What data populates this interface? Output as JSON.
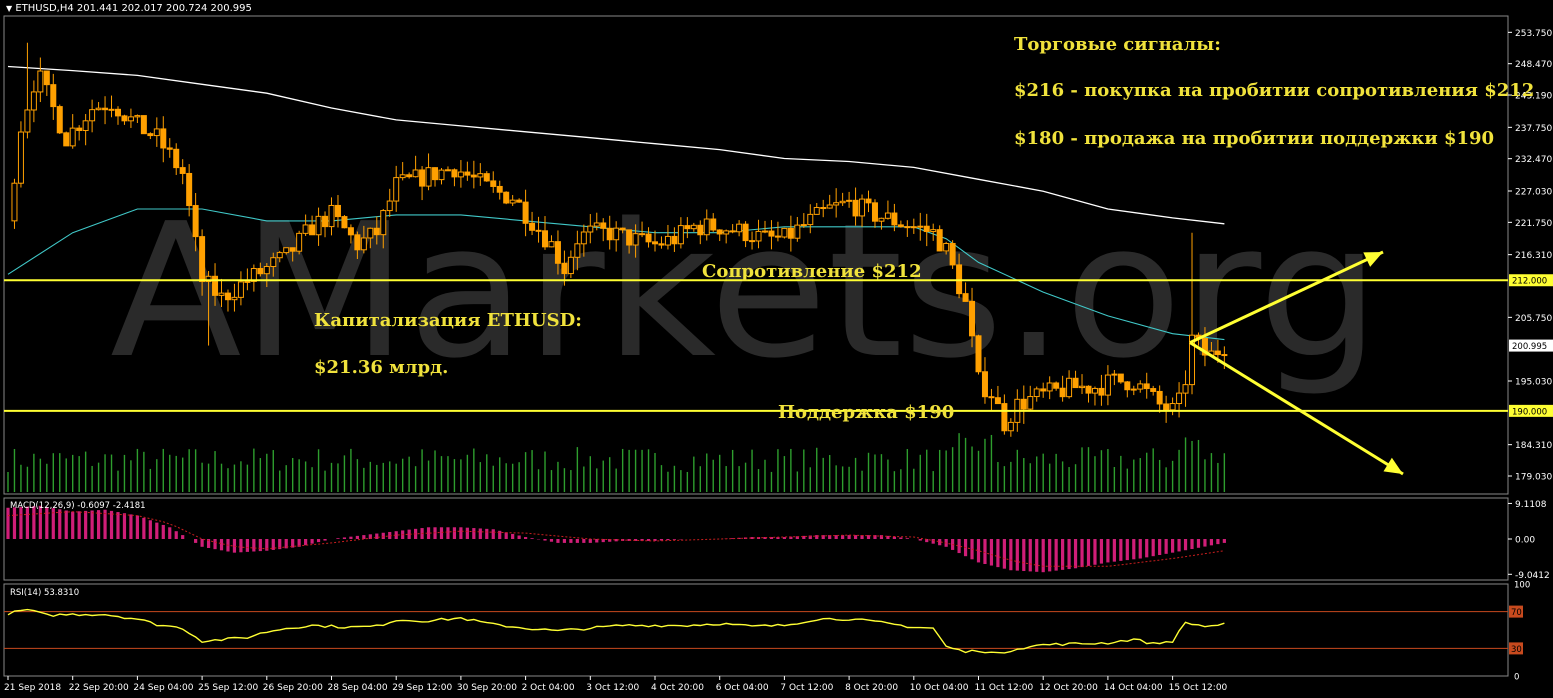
{
  "header": {
    "symbol": "ETHUSD,H4",
    "ohlc": "201.441 202.017 200.724 200.995",
    "macd_label": "MACD(12,26,9) -0.6097 -2.4181",
    "rsi_label": "RSI(14) 53.8310"
  },
  "watermark": "AMarkets.org",
  "annotations": {
    "signals_title": "Торговые сигналы:",
    "signal_buy": "$216 - покупка на пробитии сопротивления $212",
    "signal_sell": "$180 - продажа на пробитии поддержки $190",
    "resistance_label": "Сопротивление $212",
    "support_label": "Поддержка $190",
    "cap_title": "Капитализация ETHUSD:",
    "cap_value": "$21.36 млрд."
  },
  "colors": {
    "background": "#000000",
    "candle": "#ffa000",
    "level_line": "#ffff33",
    "ma_fast": "#40c8c8",
    "ma_slow": "#ffffff",
    "volume": "#2e9e2e",
    "macd_hist": "#d01e78",
    "macd_signal": "#c81e1e",
    "rsi_line": "#ffff33",
    "rsi_level": "#c84a1e",
    "annotation_text": "#f0e23c",
    "arrow": "#ffff33",
    "current_price_tag": "#ffffff"
  },
  "chart_data": [
    {
      "type": "candlestick",
      "title": "ETHUSD,H4",
      "ylim": [
        176.0,
        256.5
      ],
      "price_ticks": [
        "253.750",
        "248.470",
        "243.190",
        "237.750",
        "232.470",
        "227.030",
        "221.750",
        "216.310",
        "212.000",
        "205.750",
        "200.995",
        "195.030",
        "190.000",
        "184.310",
        "179.030"
      ],
      "x_ticks": [
        {
          "label": "21 Sep 2018",
          "x": 0
        },
        {
          "label": "22 Sep 20:00",
          "x": 1
        },
        {
          "label": "24 Sep 04:00",
          "x": 2
        },
        {
          "label": "25 Sep 12:00",
          "x": 3
        },
        {
          "label": "26 Sep 20:00",
          "x": 4
        },
        {
          "label": "28 Sep 04:00",
          "x": 5
        },
        {
          "label": "29 Sep 12:00",
          "x": 6
        },
        {
          "label": "30 Sep 20:00",
          "x": 7
        },
        {
          "label": "2 Oct 04:00",
          "x": 8
        },
        {
          "label": "3 Oct 12:00",
          "x": 9
        },
        {
          "label": "4 Oct 20:00",
          "x": 10
        },
        {
          "label": "6 Oct 04:00",
          "x": 11
        },
        {
          "label": "7 Oct 12:00",
          "x": 12
        },
        {
          "label": "8 Oct 20:00",
          "x": 13
        },
        {
          "label": "10 Oct 04:00",
          "x": 14
        },
        {
          "label": "11 Oct 12:00",
          "x": 15
        },
        {
          "label": "12 Oct 20:00",
          "x": 16
        },
        {
          "label": "14 Oct 04:00",
          "x": 17
        },
        {
          "label": "15 Oct 12:00",
          "x": 18
        }
      ],
      "levels": [
        {
          "name": "resistance",
          "value": 212.0,
          "tag": "212.000"
        },
        {
          "name": "support",
          "value": 190.0,
          "tag": "190.000"
        }
      ],
      "current_price": {
        "value": 200.995,
        "tag": "200.995"
      },
      "ohlc_keypoints": [
        [
          0.0,
          222
        ],
        [
          0.2,
          238
        ],
        [
          0.45,
          247
        ],
        [
          0.9,
          236
        ],
        [
          1.3,
          241
        ],
        [
          1.6,
          242
        ],
        [
          2.0,
          238
        ],
        [
          2.3,
          236
        ],
        [
          2.7,
          230
        ],
        [
          3.0,
          212
        ],
        [
          3.3,
          209
        ],
        [
          3.7,
          212
        ],
        [
          4.0,
          214
        ],
        [
          4.3,
          216
        ],
        [
          4.7,
          221
        ],
        [
          5.0,
          223
        ],
        [
          5.4,
          218
        ],
        [
          5.7,
          220
        ],
        [
          6.0,
          228
        ],
        [
          6.3,
          229
        ],
        [
          6.6,
          230
        ],
        [
          6.9,
          231
        ],
        [
          7.2,
          229
        ],
        [
          7.5,
          227
        ],
        [
          7.8,
          226
        ],
        [
          8.1,
          222
        ],
        [
          8.4,
          218
        ],
        [
          8.6,
          214
        ],
        [
          8.8,
          219
        ],
        [
          9.0,
          220
        ],
        [
          9.3,
          220
        ],
        [
          9.6,
          219
        ],
        [
          10.0,
          218
        ],
        [
          10.3,
          219
        ],
        [
          10.6,
          221
        ],
        [
          11.0,
          221
        ],
        [
          11.4,
          220
        ],
        [
          11.7,
          219
        ],
        [
          12.0,
          219
        ],
        [
          12.4,
          222
        ],
        [
          12.7,
          224
        ],
        [
          13.0,
          225
        ],
        [
          13.4,
          223
        ],
        [
          13.7,
          222
        ],
        [
          14.0,
          221
        ],
        [
          14.3,
          220
        ],
        [
          14.5,
          217
        ],
        [
          14.8,
          208
        ],
        [
          15.0,
          195
        ],
        [
          15.2,
          193
        ],
        [
          15.4,
          188
        ],
        [
          15.6,
          191
        ],
        [
          15.8,
          192
        ],
        [
          16.1,
          193
        ],
        [
          16.5,
          194
        ],
        [
          16.8,
          194
        ],
        [
          17.1,
          195
        ],
        [
          17.4,
          195
        ],
        [
          17.6,
          193
        ],
        [
          17.8,
          191
        ],
        [
          18.0,
          190
        ],
        [
          18.15,
          192
        ],
        [
          18.3,
          202
        ],
        [
          18.55,
          199
        ],
        [
          18.8,
          200.995
        ]
      ],
      "ma_fast": {
        "name": "",
        "x": [
          0,
          1,
          2,
          3,
          4,
          5,
          6,
          7,
          8,
          9,
          10,
          11,
          12,
          13,
          14,
          14.5,
          15,
          16,
          17,
          18,
          18.8
        ],
        "y": [
          213,
          220,
          224,
          224,
          222,
          222,
          223,
          223,
          222,
          221,
          220,
          220,
          221,
          221,
          221,
          219,
          215,
          210,
          206,
          203,
          202
        ]
      },
      "ma_slow": {
        "name": "",
        "x": [
          0,
          1,
          2,
          3,
          4,
          5,
          6,
          7,
          8,
          9,
          10,
          11,
          12,
          13,
          14,
          15,
          16,
          17,
          18,
          18.8
        ],
        "y": [
          248,
          247.3,
          246.5,
          245,
          243.5,
          241,
          239,
          238,
          237,
          236,
          235,
          234,
          232.5,
          232,
          231,
          229,
          227,
          224,
          222.5,
          221.5
        ]
      },
      "volume": {
        "max_height_fraction": 1.0,
        "pattern": "varies"
      }
    },
    {
      "type": "bar",
      "title": "MACD(12,26,9) -0.6097 -2.4181",
      "ylim": [
        -10.5,
        10.5
      ],
      "y_ticks": [
        "9.1108",
        "0.00",
        "-9.0412"
      ],
      "histogram_keypoints": [
        [
          0,
          8
        ],
        [
          0.5,
          8.5
        ],
        [
          1,
          7
        ],
        [
          1.5,
          7.5
        ],
        [
          2,
          6
        ],
        [
          2.5,
          3
        ],
        [
          3,
          -2
        ],
        [
          3.5,
          -3.5
        ],
        [
          4,
          -3
        ],
        [
          4.5,
          -2
        ],
        [
          5,
          0
        ],
        [
          5.5,
          1
        ],
        [
          6,
          2
        ],
        [
          6.5,
          3
        ],
        [
          7,
          3
        ],
        [
          7.5,
          2.5
        ],
        [
          8,
          0.5
        ],
        [
          8.5,
          -1
        ],
        [
          9,
          -1
        ],
        [
          9.5,
          -0.5
        ],
        [
          10,
          -0.5
        ],
        [
          10.5,
          0
        ],
        [
          11,
          0
        ],
        [
          11.5,
          0.5
        ],
        [
          12,
          0.5
        ],
        [
          12.5,
          1
        ],
        [
          13,
          1
        ],
        [
          13.5,
          1
        ],
        [
          14,
          0
        ],
        [
          14.5,
          -2
        ],
        [
          15,
          -6
        ],
        [
          15.5,
          -8
        ],
        [
          16,
          -8.5
        ],
        [
          16.5,
          -7.5
        ],
        [
          17,
          -6
        ],
        [
          17.5,
          -5
        ],
        [
          18,
          -3.5
        ],
        [
          18.8,
          -1
        ]
      ],
      "signal_keypoints": [
        [
          0,
          6
        ],
        [
          1,
          7
        ],
        [
          2,
          6
        ],
        [
          2.5,
          4
        ],
        [
          3,
          0
        ],
        [
          3.5,
          -2
        ],
        [
          4,
          -2.5
        ],
        [
          5,
          -1
        ],
        [
          6,
          1
        ],
        [
          7,
          2
        ],
        [
          8,
          1.5
        ],
        [
          9,
          0
        ],
        [
          10,
          -0.5
        ],
        [
          11,
          0
        ],
        [
          12,
          0.5
        ],
        [
          13,
          1
        ],
        [
          14,
          0.5
        ],
        [
          14.5,
          -1
        ],
        [
          15,
          -3
        ],
        [
          15.5,
          -5.5
        ],
        [
          16,
          -7
        ],
        [
          17,
          -7
        ],
        [
          18,
          -5
        ],
        [
          18.8,
          -3
        ]
      ]
    },
    {
      "type": "line",
      "title": "RSI(14) 53.8310",
      "ylim": [
        0,
        100
      ],
      "y_ticks": [
        "100",
        "70",
        "30",
        "0"
      ],
      "levels": [
        70,
        30
      ],
      "rsi_keypoints": [
        [
          0,
          68
        ],
        [
          0.3,
          72
        ],
        [
          0.6,
          66
        ],
        [
          1,
          67
        ],
        [
          1.5,
          67
        ],
        [
          2,
          62
        ],
        [
          2.3,
          56
        ],
        [
          2.7,
          52
        ],
        [
          3,
          38
        ],
        [
          3.4,
          40
        ],
        [
          3.7,
          42
        ],
        [
          4,
          48
        ],
        [
          4.3,
          52
        ],
        [
          4.7,
          55
        ],
        [
          5,
          54
        ],
        [
          5.3,
          53
        ],
        [
          5.7,
          54
        ],
        [
          6,
          61
        ],
        [
          6.5,
          60
        ],
        [
          7,
          63
        ],
        [
          7.5,
          56
        ],
        [
          8,
          52
        ],
        [
          8.5,
          49
        ],
        [
          9,
          52
        ],
        [
          9.5,
          55
        ],
        [
          10,
          55
        ],
        [
          10.5,
          55
        ],
        [
          11,
          57
        ],
        [
          11.5,
          54
        ],
        [
          12,
          55
        ],
        [
          12.5,
          62
        ],
        [
          13,
          62
        ],
        [
          13.5,
          58
        ],
        [
          14,
          53
        ],
        [
          14.3,
          52
        ],
        [
          14.5,
          32
        ],
        [
          14.8,
          26
        ],
        [
          15,
          28
        ],
        [
          15.3,
          24
        ],
        [
          15.6,
          30
        ],
        [
          16,
          34
        ],
        [
          16.5,
          35
        ],
        [
          17,
          36
        ],
        [
          17.4,
          40
        ],
        [
          17.7,
          35
        ],
        [
          18,
          38
        ],
        [
          18.2,
          58
        ],
        [
          18.5,
          54
        ],
        [
          18.8,
          56
        ]
      ]
    }
  ]
}
